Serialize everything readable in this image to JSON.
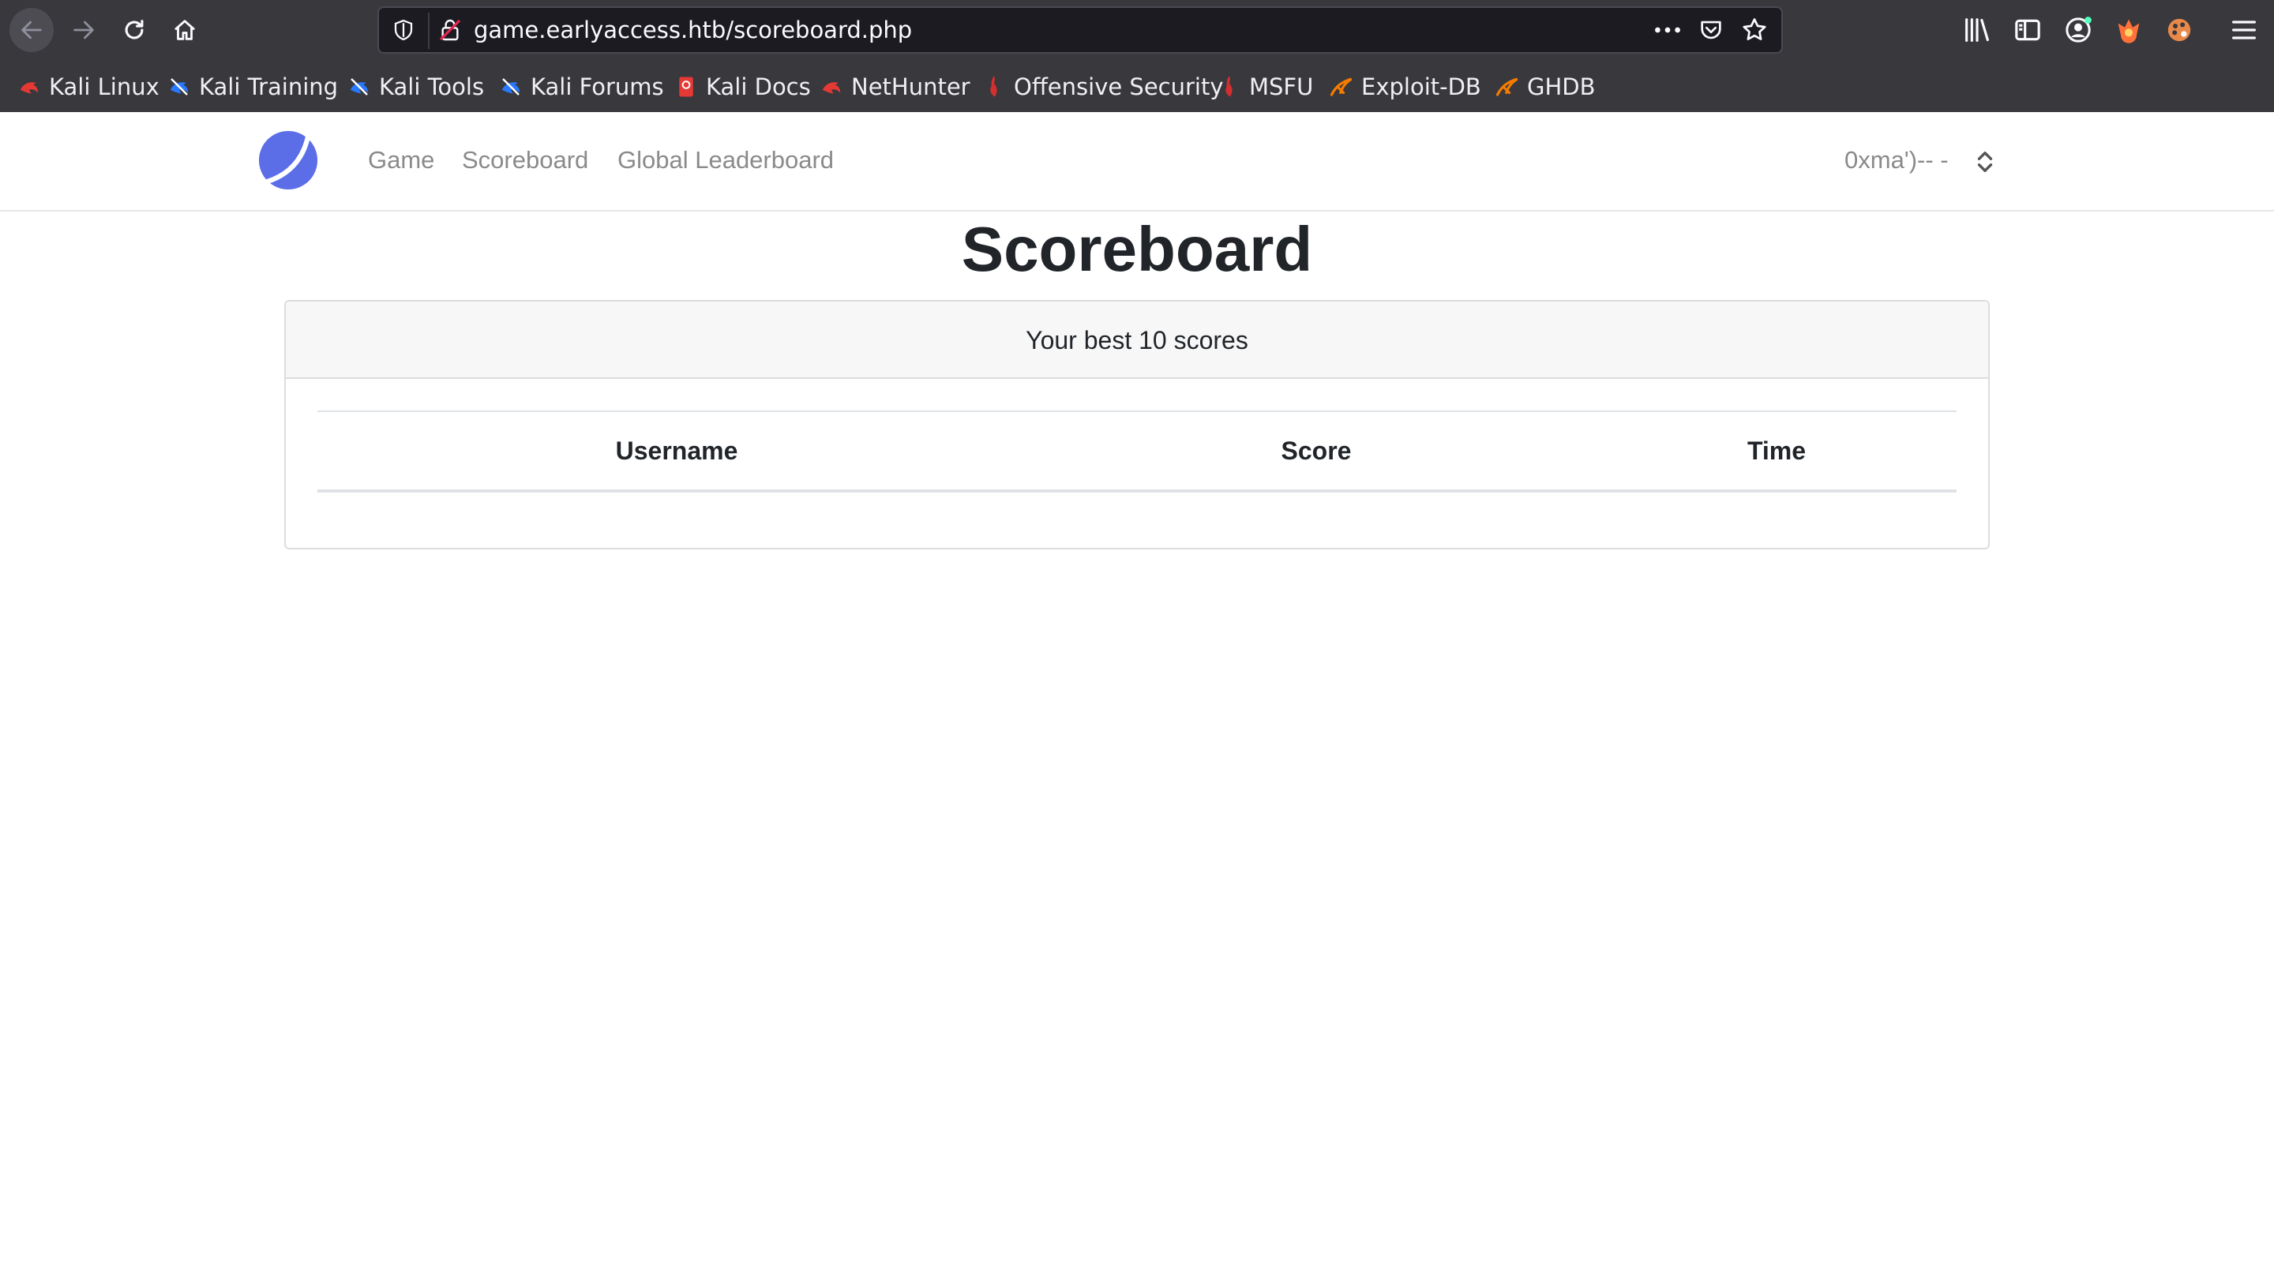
{
  "browser": {
    "url": "game.earlyaccess.htb/scoreboard.php",
    "icons": {
      "back": "arrow-left-icon",
      "forward": "arrow-right-icon",
      "reload": "reload-icon",
      "home": "home-icon",
      "tracking": "shield-icon",
      "connection": "insecure-lock-icon",
      "page_actions": "more-horizontal-icon",
      "pocket": "pocket-icon",
      "bookmark": "star-icon",
      "library": "library-icon",
      "sidebar": "sidebar-icon",
      "account": "account-icon",
      "menu": "hamburger-menu-icon"
    },
    "bookmarks": [
      {
        "label": "Kali Linux",
        "icon": "kali-dragon-icon",
        "color": "#e53935"
      },
      {
        "label": "Kali Training",
        "icon": "kali-training-icon",
        "color": "#2979ff"
      },
      {
        "label": "Kali Tools",
        "icon": "kali-tools-icon",
        "color": "#2979ff"
      },
      {
        "label": "Kali Forums",
        "icon": "kali-forums-icon",
        "color": "#2979ff"
      },
      {
        "label": "Kali Docs",
        "icon": "kali-docs-icon",
        "color": "#e53935"
      },
      {
        "label": "NetHunter",
        "icon": "nethunter-icon",
        "color": "#e53935"
      },
      {
        "label": "Offensive Security",
        "icon": "offsec-icon",
        "color": "#d32f2f"
      },
      {
        "label": "MSFU",
        "icon": "msfu-icon",
        "color": "#d32f2f"
      },
      {
        "label": "Exploit-DB",
        "icon": "exploitdb-icon",
        "color": "#f57c00"
      },
      {
        "label": "GHDB",
        "icon": "ghdb-icon",
        "color": "#f57c00"
      }
    ]
  },
  "site": {
    "brand_icon": "planet-logo-icon",
    "brand_color": "#5b6ee8",
    "nav": {
      "game": "Game",
      "scoreboard": "Scoreboard",
      "global_leaderboard": "Global Leaderboard"
    },
    "user": {
      "name": "0xma')-- -",
      "caret_icon": "chevron-up-down-icon"
    }
  },
  "main": {
    "title": "Scoreboard",
    "card_header": "Your best 10 scores",
    "table": {
      "columns": [
        "Username",
        "Score",
        "Time"
      ],
      "rows": []
    }
  }
}
